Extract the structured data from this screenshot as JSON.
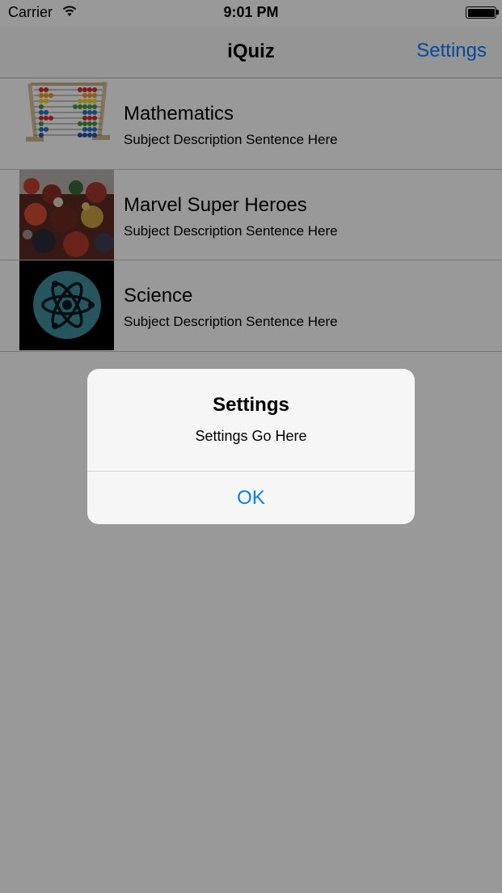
{
  "status_bar": {
    "carrier": "Carrier",
    "time": "9:01 PM"
  },
  "nav": {
    "title": "iQuiz",
    "settings_label": "Settings"
  },
  "subjects": [
    {
      "title": "Mathematics",
      "description": "Subject Description Sentence Here",
      "icon": "abacus-icon"
    },
    {
      "title": "Marvel Super Heroes",
      "description": "Subject Description Sentence Here",
      "icon": "marvel-heroes-image"
    },
    {
      "title": "Science",
      "description": "Subject Description Sentence Here",
      "icon": "atom-icon"
    }
  ],
  "alert": {
    "title": "Settings",
    "message": "Settings Go Here",
    "ok_label": "OK"
  },
  "colors": {
    "accent": "#0a7aff",
    "dim_overlay": "rgba(0,0,0,0.4)",
    "alert_bg": "#f6f6f6"
  }
}
